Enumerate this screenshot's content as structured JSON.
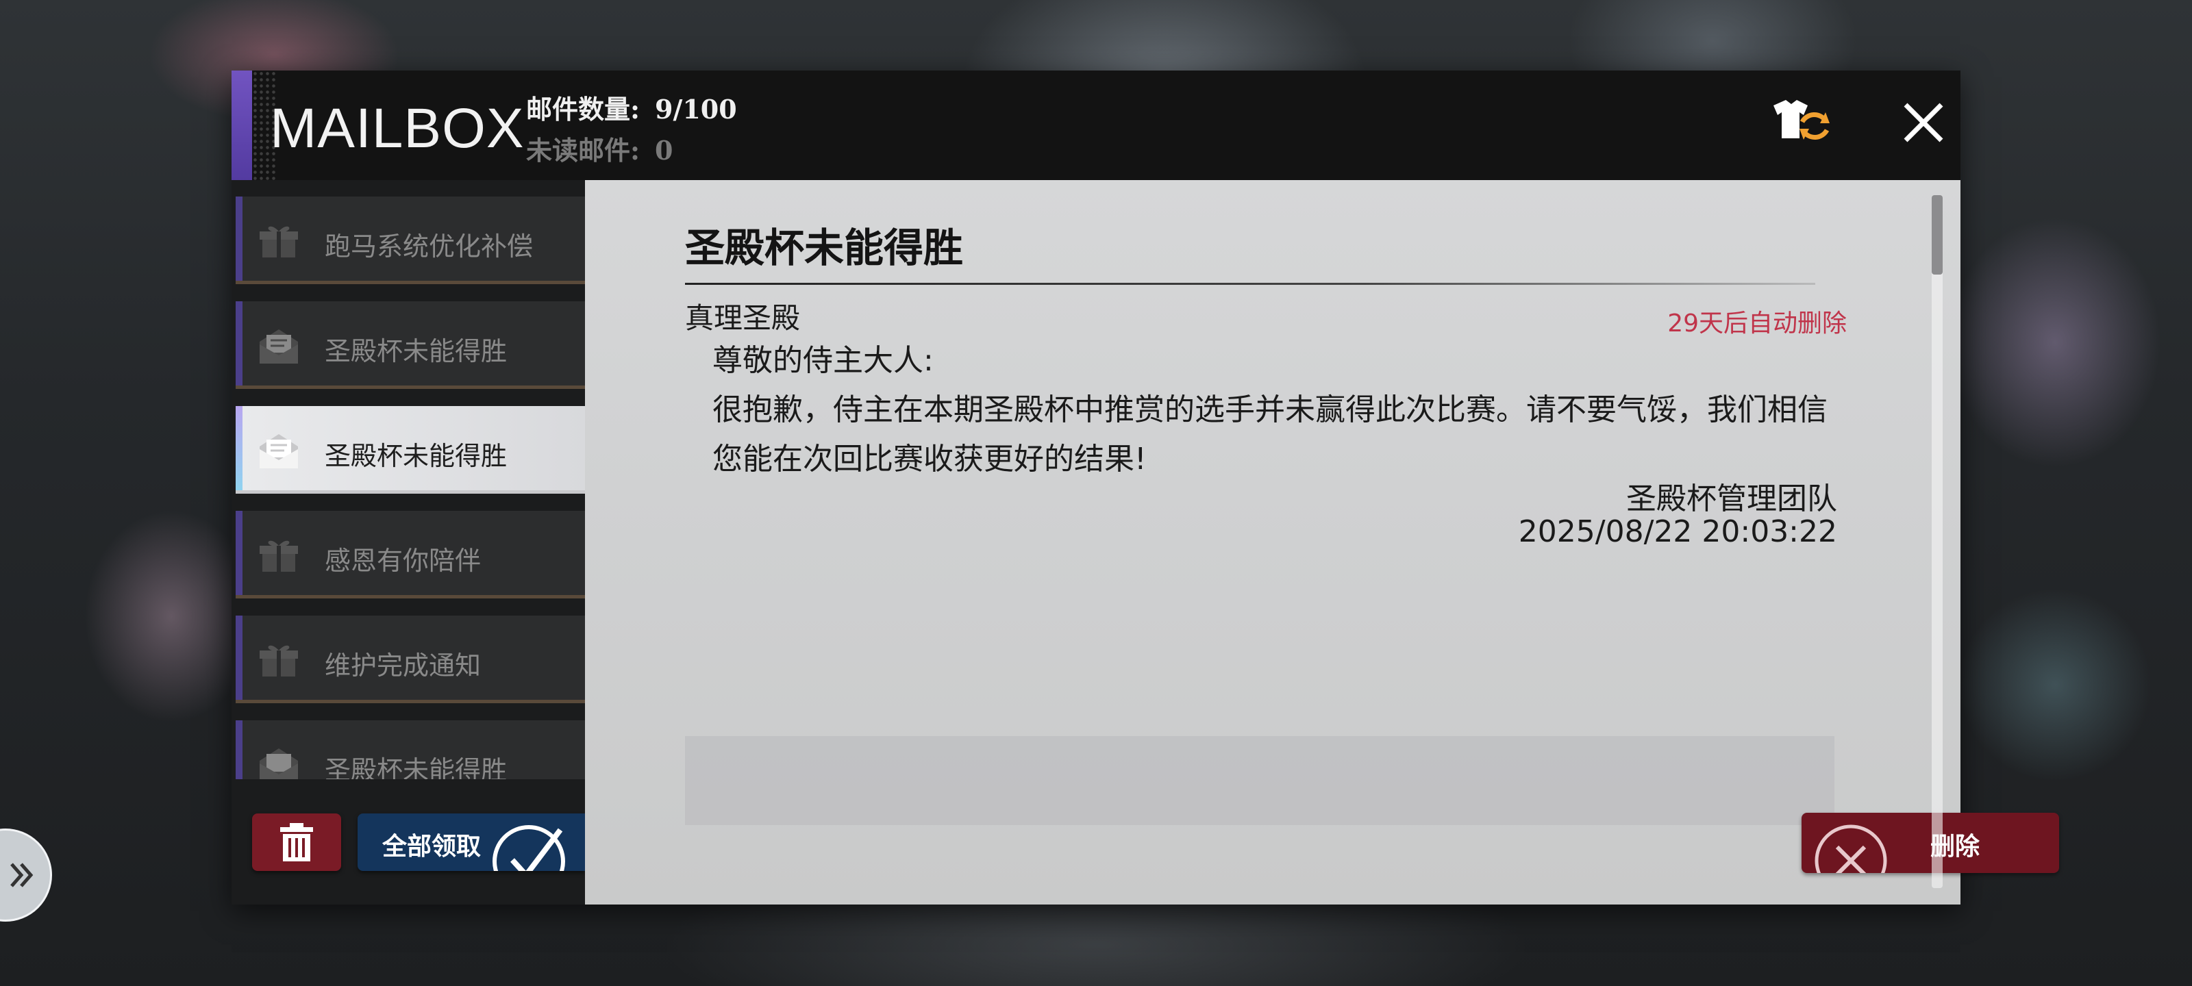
{
  "header": {
    "title": "MAILBOX",
    "mail_count_label": "邮件数量:",
    "mail_count_value": "9/100",
    "unread_label": "未读邮件:",
    "unread_value": "0",
    "skin_icon": "outfit-refresh-icon",
    "close_icon": "close-icon"
  },
  "sidebar": {
    "items": [
      {
        "label": "跑马系统优化补偿",
        "icon": "gift-box-icon",
        "state": "read"
      },
      {
        "label": "圣殿杯未能得胜",
        "icon": "open-envelope-icon",
        "state": "read"
      },
      {
        "label": "圣殿杯未能得胜",
        "icon": "open-envelope-icon",
        "state": "selected"
      },
      {
        "label": "感恩有你陪伴",
        "icon": "gift-box-icon",
        "state": "read"
      },
      {
        "label": "维护完成通知",
        "icon": "gift-box-icon",
        "state": "read"
      },
      {
        "label": "圣殿杯未能得胜",
        "icon": "open-envelope-icon",
        "state": "read"
      }
    ],
    "trash_icon": "trash-icon",
    "claim_all_label": "全部领取",
    "claim_icon": "checkmark-icon"
  },
  "mail": {
    "title": "圣殿杯未能得胜",
    "sender": "真理圣殿",
    "auto_delete": "29天后自动删除",
    "greeting": "尊敬的侍主大人:",
    "body": "很抱歉，侍主在本期圣殿杯中推赏的选手并未赢得此次比赛。请不要气馁，我们相信您能在次回比赛收获更好的结果!",
    "signature": "圣殿杯管理团队",
    "timestamp": "2025/08/22 20:03:22",
    "delete_label": "删除",
    "delete_icon": "x-circle-icon"
  },
  "colors": {
    "header_bg": "#131313",
    "accent_purple": "#5a3fb0",
    "danger_red": "#7a1b26",
    "claim_blue": "#14355c",
    "auto_delete_red": "#c0344a"
  }
}
